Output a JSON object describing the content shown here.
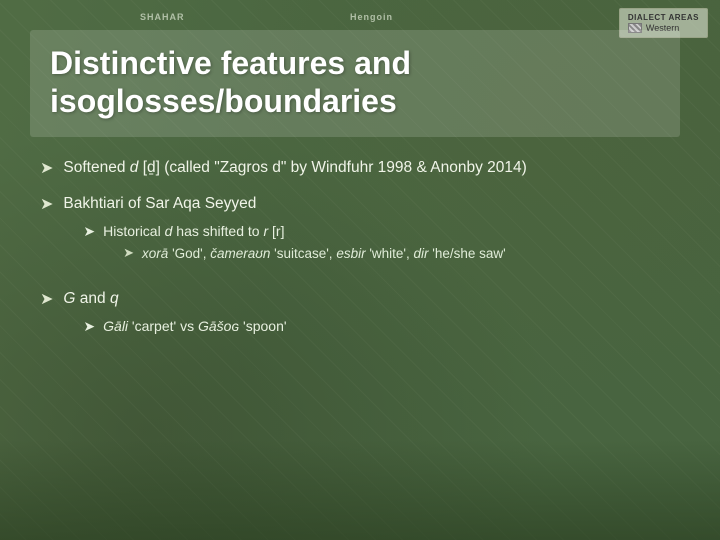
{
  "slide": {
    "title_line1": "Distinctive features and",
    "title_line2": "isoglosses/boundaries",
    "top_legend": {
      "label_dialect": "DIALECT AREAS",
      "label_western": "Western"
    },
    "map_labels": {
      "shahar": "SHAHAR",
      "hengoin": "Hengoin"
    },
    "bullets": [
      {
        "id": "bullet1",
        "text": "Softened d [ḏ] (called “Zagros d” by Windfuhr 1998 & Anonby 2014)",
        "sub_bullets": []
      },
      {
        "id": "bullet2",
        "text": "Bakhtiari of Sar Aqa Seyyed",
        "sub_bullets": [
          {
            "id": "sub1",
            "text": "Historical d has shifted to r [r]",
            "sub_sub_bullets": [
              {
                "id": "subsub1",
                "text": "xorā ‘God’, čameraʊn ‘suitcase’, esbir ‘white’, dir ‘he/she saw’"
              }
            ]
          }
        ]
      },
      {
        "id": "bullet3",
        "text": "G and q",
        "sub_bullets": [
          {
            "id": "sub2",
            "text": "Gāli ‘carpet’ vs Gāšoɢ ‘spoon’",
            "sub_sub_bullets": []
          }
        ]
      }
    ]
  }
}
